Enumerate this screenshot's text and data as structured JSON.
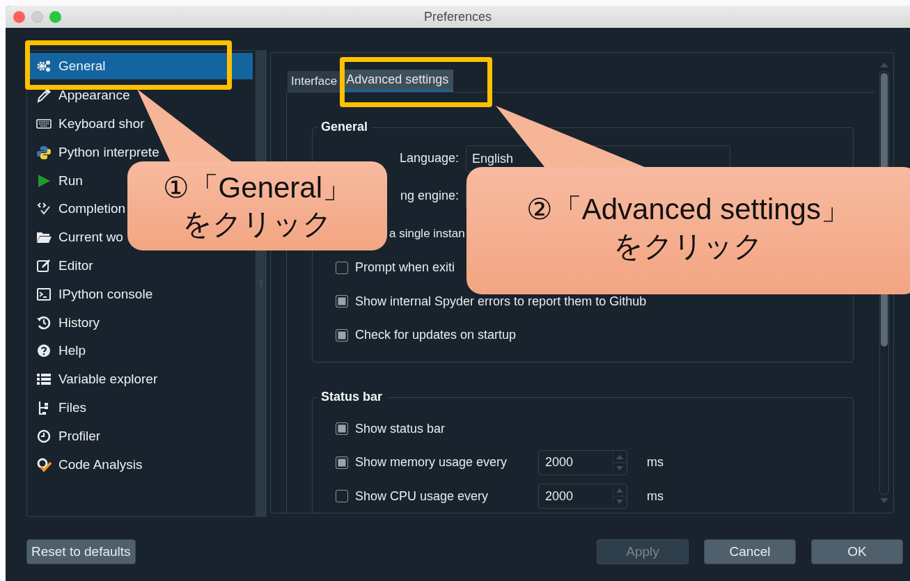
{
  "window": {
    "title": "Preferences"
  },
  "sidebar": {
    "items": [
      {
        "label": "General",
        "selected": true
      },
      {
        "label": "Appearance",
        "selected": false
      },
      {
        "label": "Keyboard shor",
        "selected": false
      },
      {
        "label": "Python interprete",
        "selected": false
      },
      {
        "label": "Run",
        "selected": false
      },
      {
        "label": "Completion",
        "selected": false
      },
      {
        "label": "Current wo",
        "selected": false
      },
      {
        "label": "Editor",
        "selected": false
      },
      {
        "label": "IPython console",
        "selected": false
      },
      {
        "label": "History",
        "selected": false
      },
      {
        "label": "Help",
        "selected": false
      },
      {
        "label": "Variable explorer",
        "selected": false
      },
      {
        "label": "Files",
        "selected": false
      },
      {
        "label": "Profiler",
        "selected": false
      },
      {
        "label": "Code Analysis",
        "selected": false
      }
    ]
  },
  "tabs": [
    {
      "label": "Interface",
      "selected": false
    },
    {
      "label": "Advanced settings",
      "selected": true
    }
  ],
  "groups": [
    {
      "title": "General",
      "rows": [
        {
          "kind": "combo",
          "label": "Language:",
          "value": "English"
        },
        {
          "kind": "combo",
          "label": "ng engine:"
        },
        {
          "kind": "check",
          "label": "a single instan"
        },
        {
          "kind": "check",
          "label": "Prompt when exiti",
          "checked": false
        },
        {
          "kind": "check",
          "label": "Show internal Spyder errors to report them to Github",
          "checked": true
        },
        {
          "kind": "check",
          "label": "Check for updates on startup",
          "checked": true
        }
      ]
    },
    {
      "title": "Status bar",
      "rows": [
        {
          "kind": "check",
          "label": "Show status bar",
          "checked": true
        },
        {
          "kind": "spin",
          "label": "Show memory usage every",
          "checked": true,
          "value": "2000",
          "unit": "ms"
        },
        {
          "kind": "spin",
          "label": "Show CPU usage every",
          "checked": false,
          "value": "2000",
          "unit": "ms"
        }
      ]
    }
  ],
  "buttons": [
    {
      "label": "Reset to defaults",
      "disabled": false
    },
    {
      "label": "Apply",
      "disabled": true
    },
    {
      "label": "Cancel",
      "disabled": false
    },
    {
      "label": "OK",
      "disabled": false
    }
  ],
  "callouts": [
    {
      "lines": [
        "①「General」",
        "をクリック"
      ]
    },
    {
      "lines": [
        "②「Advanced settings」",
        "をクリック"
      ]
    }
  ]
}
